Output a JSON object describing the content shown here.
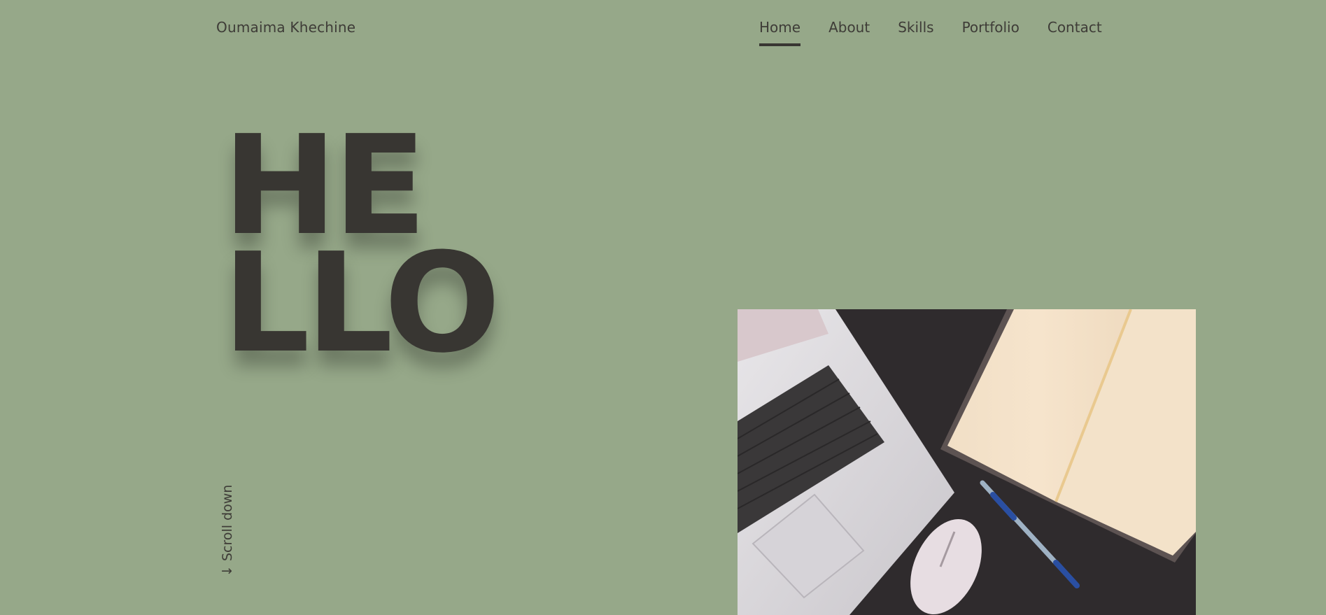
{
  "brand": {
    "name": "Oumaima Khechine"
  },
  "nav": {
    "items": [
      {
        "label": "Home",
        "active": true
      },
      {
        "label": "About",
        "active": false
      },
      {
        "label": "Skills",
        "active": false
      },
      {
        "label": "Portfolio",
        "active": false
      },
      {
        "label": "Contact",
        "active": false
      }
    ]
  },
  "hero": {
    "line1": "HE",
    "line2": "LLO",
    "scroll_label": "↓ Scroll down",
    "image_subject": "laptop-mouse-pen-notebook-photo"
  },
  "colors": {
    "background": "#96a889",
    "text": "#383632",
    "photo_desk": "#2f2b2d"
  }
}
